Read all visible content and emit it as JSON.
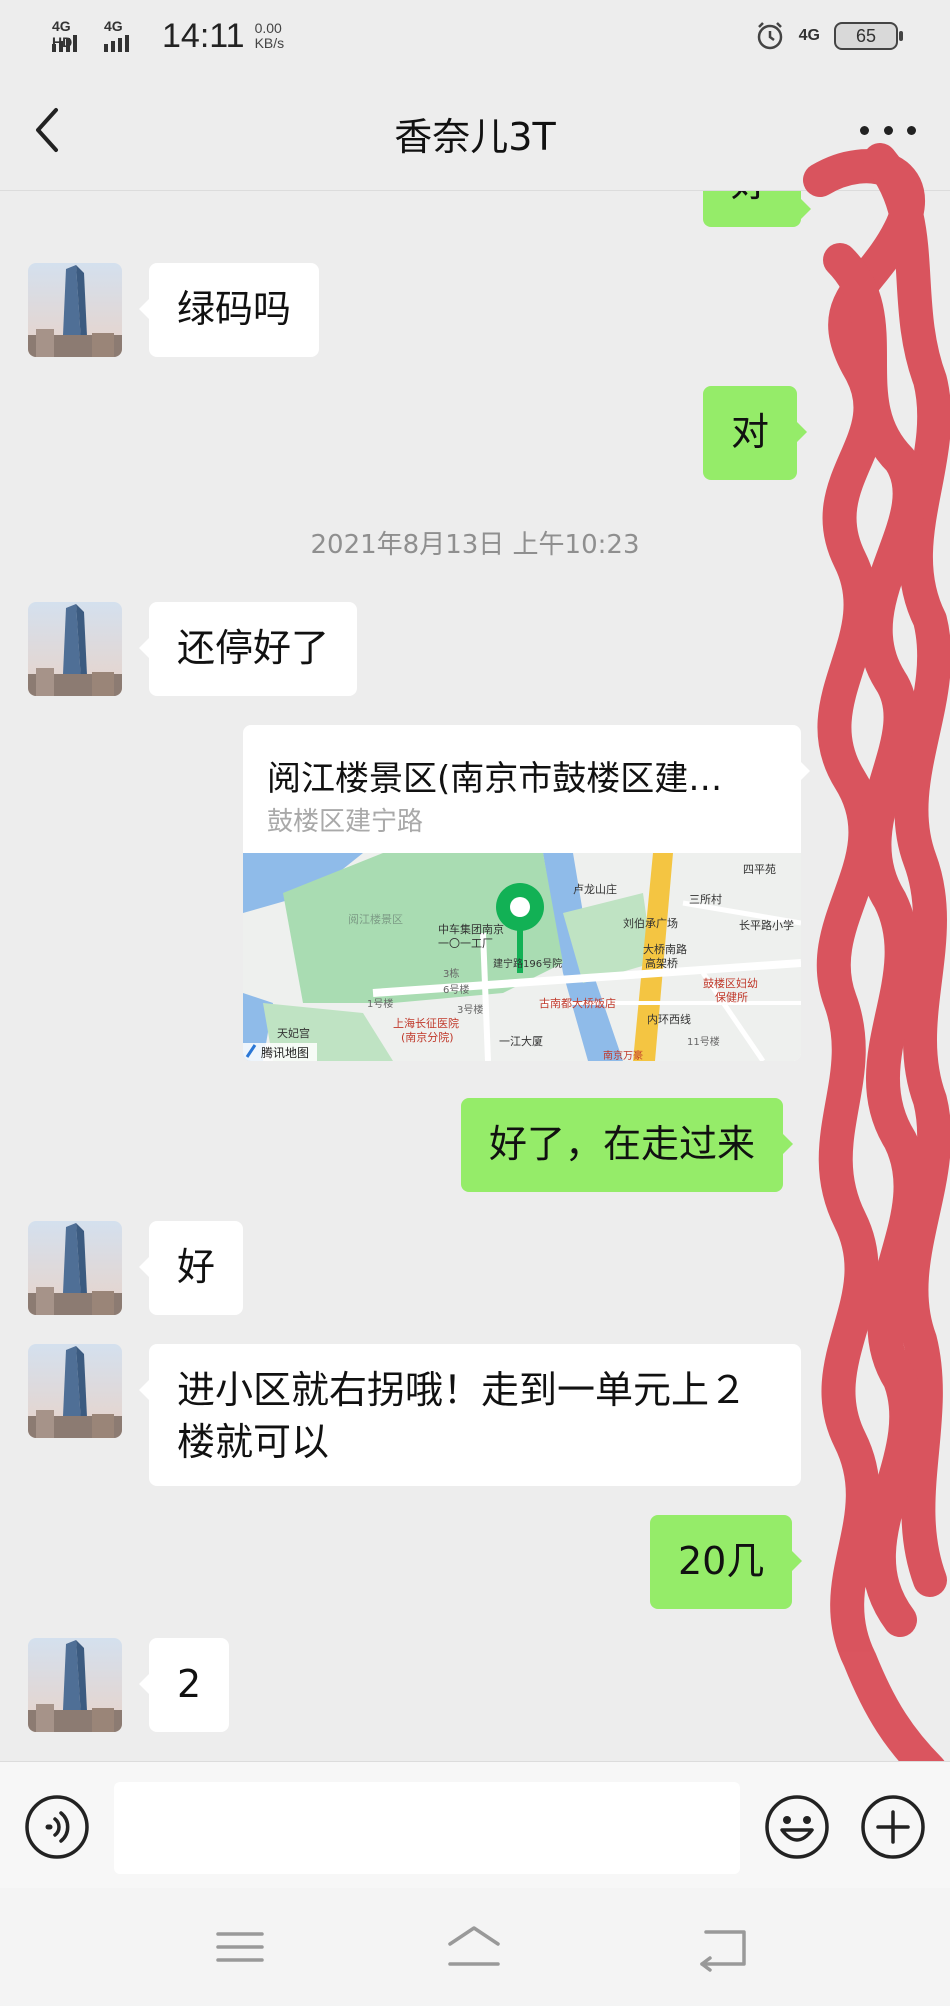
{
  "status_bar": {
    "net_left_1": "4G HD",
    "net_left_2": "4G",
    "time": "14:11",
    "speed_value": "0.00",
    "speed_unit": "KB/s",
    "net_right": "4G",
    "battery": "65",
    "icons": [
      "signal-icon",
      "alarm-icon",
      "battery-icon"
    ]
  },
  "header": {
    "title": "香奈儿3T",
    "back_icon": "chevron-left-icon",
    "more_icon": "more-dots-icon"
  },
  "messages": [
    {
      "side": "out",
      "text": "好"
    },
    {
      "side": "in",
      "text": "绿码吗"
    },
    {
      "side": "out",
      "text": "对"
    },
    {
      "type": "timestamp",
      "text": "2021年8月13日 上午10:23"
    },
    {
      "side": "in",
      "text": "还停好了"
    },
    {
      "side": "out",
      "type": "location",
      "title": "阅江楼景区(南京市鼓楼区建…",
      "subtitle": "鼓楼区建宁路",
      "map_provider": "腾讯地图"
    },
    {
      "side": "out",
      "text": "好了，在走过来"
    },
    {
      "side": "in",
      "text": "好"
    },
    {
      "side": "in",
      "text": "进小区就右拐哦！走到一单元上２楼就可以"
    },
    {
      "side": "out",
      "text": "20几"
    },
    {
      "side": "in",
      "text": "2"
    }
  ],
  "map_labels": {
    "l1": "阅江楼景区",
    "l2": "中车集团南京",
    "l3": "一〇一工厂",
    "l4": "建宁路196号院",
    "l5": "卢龙山庄",
    "l6": "刘伯承广场",
    "l7": "大桥南路",
    "l8": "高架桥",
    "l9": "四平苑",
    "l10": "三所村",
    "l11": "长平路小学",
    "l12": "鼓楼区妇幼",
    "l13": "保健所",
    "l14": "古南都大桥饭店",
    "l15": "上海长征医院",
    "l16": "(南京分院)",
    "l17": "天妃宫",
    "l18": "一江大厦",
    "l19": "内环西线",
    "l20": "3栋",
    "l21": "6号楼",
    "l22": "1号楼",
    "l23": "3号楼",
    "l24": "11号楼",
    "l25": "南京万豪"
  },
  "input_bar": {
    "placeholder": "",
    "voice_icon": "voice-icon",
    "emoji_icon": "emoji-icon",
    "plus_icon": "plus-icon"
  },
  "nav_bar": {
    "icons": [
      "menu-icon",
      "home-icon",
      "back-icon"
    ]
  },
  "colors": {
    "background": "#ededed",
    "out_bubble": "#95ec69",
    "in_bubble": "#ffffff",
    "timestamp": "#8f8f8f",
    "scribble": "#d9505a"
  }
}
